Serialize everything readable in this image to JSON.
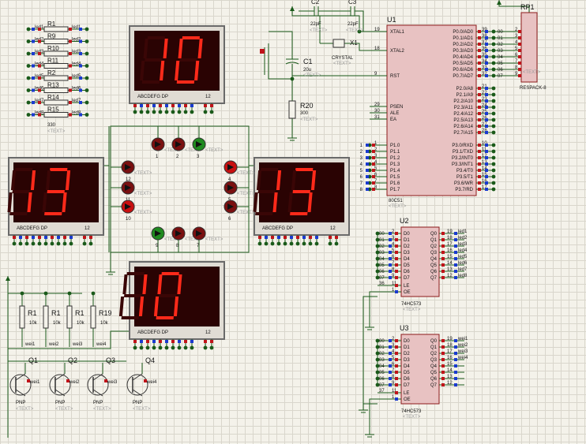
{
  "text_placeholder": "<TEXT>",
  "displays": [
    {
      "id": "top",
      "digits": "10",
      "pins": "ABCDEFG DP",
      "num": "12"
    },
    {
      "id": "left",
      "digits": "13",
      "pins": "ABCDEFG DP",
      "num": "12"
    },
    {
      "id": "right",
      "digits": "13",
      "pins": "ABCDEFG DP",
      "num": "12"
    },
    {
      "id": "bottom",
      "digits": "10",
      "pins": "ABCDEFG DP",
      "num": "12"
    }
  ],
  "mcu": {
    "ref": "U1",
    "part": "80C51",
    "left_pins": [
      {
        "num": "19",
        "name": "XTAL1"
      },
      {
        "num": "18",
        "name": "XTAL2"
      },
      {
        "num": "9",
        "name": "RST"
      },
      {
        "num": "29",
        "name": "PSEN"
      },
      {
        "num": "30",
        "name": "ALE"
      },
      {
        "num": "31",
        "name": "EA"
      },
      {
        "num": "1",
        "name": "P1.0"
      },
      {
        "num": "2",
        "name": "P1.1"
      },
      {
        "num": "3",
        "name": "P1.2"
      },
      {
        "num": "4",
        "name": "P1.3"
      },
      {
        "num": "5",
        "name": "P1.4"
      },
      {
        "num": "6",
        "name": "P1.5"
      },
      {
        "num": "7",
        "name": "P1.6"
      },
      {
        "num": "8",
        "name": "P1.7"
      }
    ],
    "right_pins": [
      {
        "num": "39",
        "name": "P0.0/AD0"
      },
      {
        "num": "38",
        "name": "P0.1/AD1"
      },
      {
        "num": "37",
        "name": "P0.2/AD2"
      },
      {
        "num": "36",
        "name": "P0.3/AD3"
      },
      {
        "num": "35",
        "name": "P0.4/AD4"
      },
      {
        "num": "34",
        "name": "P0.5/AD5"
      },
      {
        "num": "33",
        "name": "P0.6/AD6"
      },
      {
        "num": "32",
        "name": "P0.7/AD7"
      },
      {
        "num": "21",
        "name": "P2.0/A8"
      },
      {
        "num": "22",
        "name": "P2.1/A9"
      },
      {
        "num": "23",
        "name": "P2.2/A10"
      },
      {
        "num": "24",
        "name": "P2.3/A11"
      },
      {
        "num": "25",
        "name": "P2.4/A12"
      },
      {
        "num": "26",
        "name": "P2.5/A13"
      },
      {
        "num": "27",
        "name": "P2.6/A14"
      },
      {
        "num": "28",
        "name": "P2.7/A15"
      },
      {
        "num": "10",
        "name": "P3.0/RXD"
      },
      {
        "num": "11",
        "name": "P3.1/TXD"
      },
      {
        "num": "12",
        "name": "P3.2/INT0"
      },
      {
        "num": "13",
        "name": "P3.3/INT1"
      },
      {
        "num": "14",
        "name": "P3.4/T0"
      },
      {
        "num": "15",
        "name": "P3.5/T1"
      },
      {
        "num": "16",
        "name": "P3.6/WR"
      },
      {
        "num": "17",
        "name": "P3.7/RD"
      }
    ],
    "p1_nets": [
      "1",
      "2",
      "3",
      "4",
      "5",
      "6",
      "7",
      "8"
    ]
  },
  "rp1": {
    "ref": "RP1",
    "part": "RESPACK-8",
    "pins": [
      "2",
      "3",
      "4",
      "5",
      "6",
      "7",
      "8",
      "9"
    ],
    "nets": [
      "00",
      "01",
      "02",
      "03",
      "04",
      "05",
      "06",
      "07"
    ]
  },
  "latches": [
    {
      "ref": "U2",
      "part": "74HC573",
      "in_pins": [
        "2",
        "3",
        "4",
        "5",
        "6",
        "7",
        "8",
        "9"
      ],
      "in_nets": [
        "00",
        "01",
        "02",
        "03",
        "04",
        "05",
        "06",
        "07"
      ],
      "inputs": [
        "D0",
        "D1",
        "D2",
        "D3",
        "D4",
        "D5",
        "D6",
        "D7"
      ],
      "outputs": [
        "Q0",
        "Q1",
        "Q2",
        "Q3",
        "Q4",
        "Q5",
        "Q6",
        "Q7"
      ],
      "out_pins": [
        "19",
        "18",
        "17",
        "16",
        "15",
        "14",
        "13",
        "12"
      ],
      "out_nets": [
        "led1",
        "led2",
        "led3",
        "led4",
        "led5",
        "led6",
        "led7",
        "led8"
      ],
      "le_pin": "11",
      "le_net": "36",
      "oe_pin": "1",
      "le": "LE",
      "oe": "OE"
    },
    {
      "ref": "U3",
      "part": "74HC573",
      "in_pins": [
        "2",
        "3",
        "4",
        "5",
        "6",
        "7",
        "8",
        "9"
      ],
      "in_nets": [
        "00",
        "01",
        "02",
        "03",
        "04",
        "05",
        "06",
        "07"
      ],
      "inputs": [
        "D0",
        "D1",
        "D2",
        "D3",
        "D4",
        "D5",
        "D6",
        "D7"
      ],
      "outputs": [
        "Q0",
        "Q1",
        "Q2",
        "Q3",
        "Q4",
        "Q5",
        "Q6",
        "Q7"
      ],
      "out_pins": [
        "19",
        "18",
        "17",
        "16",
        "15",
        "14",
        "13",
        "12"
      ],
      "out_nets": [
        "wei1",
        "wei2",
        "wei3",
        "wei4",
        "",
        "",
        "",
        ""
      ],
      "le_pin": "11",
      "le_net": "37",
      "oe_pin": "1",
      "le": "LE",
      "oe": "OE"
    }
  ],
  "crystal": {
    "c2": "C2",
    "c2_val": "22pF",
    "c3": "C3",
    "c3_val": "22pF",
    "x1": "X1",
    "x1_val": "CRYSTAL"
  },
  "reset": {
    "c1": "C1",
    "c1_val": "20u",
    "r20": "R20",
    "r20_val": "300"
  },
  "resistor_bank": {
    "labels": [
      "R1",
      "R9",
      "R10",
      "R11",
      "R2",
      "R13",
      "R14",
      "R15"
    ],
    "in_nets": [
      "led1",
      "led2",
      "led3",
      "led4",
      "led5",
      "led6",
      "led7",
      "led8"
    ],
    "out_nets": [
      "led1",
      "led2",
      "led3",
      "led4",
      "led5",
      "led6",
      "led7",
      "led8"
    ],
    "value": "330"
  },
  "leds": {
    "top_nums": [
      "1",
      "2",
      "3"
    ],
    "right_nums": [
      "4",
      "5",
      "6"
    ],
    "left_nums": [
      "12",
      "11",
      "10"
    ],
    "bottom_nums": [
      "9",
      "8",
      "7"
    ],
    "top_colors": [
      "#7a1010",
      "#7a1010",
      "#1f8a1f"
    ],
    "right_colors": [
      "#c81010",
      "#7a1010",
      "#7a1010"
    ],
    "left_colors": [
      "#7a1010",
      "#7a1010",
      "#c81010"
    ],
    "bottom_colors": [
      "#1f8a1f",
      "#7a1010",
      "#7a1010"
    ]
  },
  "drivers": {
    "resistors": [
      {
        "ref": "R1",
        "val": "10k"
      },
      {
        "ref": "R1",
        "val": "10k"
      },
      {
        "ref": "R1",
        "val": "10k"
      },
      {
        "ref": "R19",
        "val": "10k"
      }
    ],
    "transistors": [
      {
        "ref": "Q1",
        "type": "PNP",
        "net": "wei1"
      },
      {
        "ref": "Q2",
        "type": "PNP",
        "net": "wei2"
      },
      {
        "ref": "Q3",
        "type": "PNP",
        "net": "wei3"
      },
      {
        "ref": "Q4",
        "type": "PNP",
        "net": "wei4"
      }
    ],
    "wei_labels": [
      "wei1",
      "wei2",
      "wei3",
      "wei4"
    ]
  },
  "colors": {
    "wire": "#1a5a1a",
    "body": "#e8c2c2",
    "outline": "#8b1a1a",
    "seg_on": "#ff2a1a",
    "seg_off": "#3a0606",
    "display_bg": "#2a0303",
    "display_frame": "#6a6a6a",
    "pin_red": "#c0141a",
    "pin_blue": "#1a3ad0"
  }
}
